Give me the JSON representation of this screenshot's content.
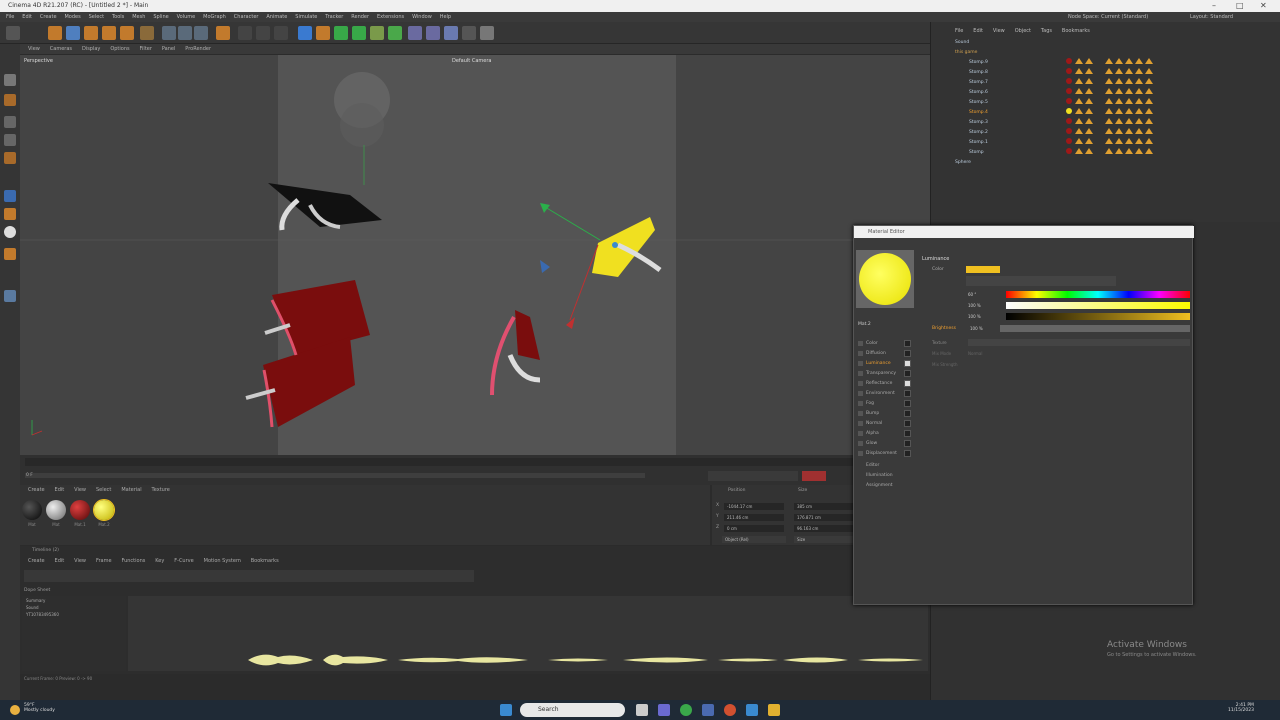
{
  "window": {
    "title": "Cinema 4D R21.207 (RC) - [Untitled 2 *] - Main"
  },
  "menu": [
    "File",
    "Edit",
    "Create",
    "Modes",
    "Select",
    "Tools",
    "Mesh",
    "Spline",
    "Volume",
    "MoGraph",
    "Character",
    "Animate",
    "Simulate",
    "Tracker",
    "Render",
    "Extensions",
    "Window",
    "Help"
  ],
  "node_space": "Node Space: Current (Standard)",
  "layout": "Layout: Standard",
  "viewport": {
    "menu": [
      "View",
      "Cameras",
      "Display",
      "Options",
      "Filter",
      "Panel",
      "ProRender"
    ],
    "label": "Perspective",
    "camera": "Default Camera"
  },
  "materials": {
    "menu": [
      "Create",
      "Edit",
      "View",
      "Select",
      "Material",
      "Texture"
    ],
    "items": [
      {
        "name": "Mat",
        "color": "#111111"
      },
      {
        "name": "Mat",
        "color": "#aaaaaa"
      },
      {
        "name": "Mat.1",
        "color": "#aa1111"
      },
      {
        "name": "Mat.2",
        "color": "#f0e020"
      }
    ]
  },
  "coords": {
    "headers": [
      "Position",
      "Size"
    ],
    "rows": [
      {
        "axis": "X",
        "pos": "-1044.17 cm",
        "size": "385 cm"
      },
      {
        "axis": "Y",
        "pos": "211.46 cm",
        "size": "176.871 cm"
      },
      {
        "axis": "Z",
        "pos": "0 cm",
        "size": "96.163 cm"
      }
    ],
    "mode": "Object (Rel)",
    "size_mode": "Size"
  },
  "timeline": {
    "title": "Timeline (2)",
    "menu": [
      "Create",
      "Edit",
      "View",
      "Frame",
      "Functions",
      "Key",
      "F-Curve",
      "Motion System",
      "Bookmarks"
    ],
    "tracks": [
      "Summary",
      "Sound",
      "YT10783495360"
    ],
    "label": "Dope Sheet",
    "frame": "0 F"
  },
  "status": "Current Frame: 0   Preview: 0 -> 90",
  "objects": {
    "menu": [
      "File",
      "Edit",
      "View",
      "Object",
      "Tags",
      "Bookmarks"
    ],
    "rows": [
      "Sound",
      "this game",
      "Stomp.9",
      "Stomp.8",
      "Stomp.7",
      "Stomp.6",
      "Stomp.5",
      "Stomp.4",
      "Stomp.3",
      "Stomp.2",
      "Stomp.1",
      "Stomp",
      "Sphere"
    ]
  },
  "picker": {
    "title": "Material Editor",
    "mat_name": "Mat.2",
    "section": "Luminance",
    "color_label": "Color",
    "h": "60 °",
    "s": "100 %",
    "v": "100 %",
    "brightness_label": "Brightness",
    "brightness": "100 %",
    "texture": "Texture",
    "mix_mode": "Mix Mode",
    "mix_mode_value": "Normal",
    "mix_strength": "Mix Strength",
    "channels": [
      "Color",
      "Diffusion",
      "Luminance",
      "Transparency",
      "Reflectance",
      "Environment",
      "Fog",
      "Bump",
      "Normal",
      "Alpha",
      "Glow",
      "Displacement",
      "Editor",
      "Illumination",
      "Assignment"
    ],
    "accent": "#f0c020"
  },
  "activate": {
    "line1": "Activate Windows",
    "line2": "Go to Settings to activate Windows."
  },
  "taskbar": {
    "weather_temp": "59°F",
    "weather": "Mostly cloudy",
    "search": "Search",
    "time": "2:41 PM",
    "date": "11/15/2023"
  }
}
